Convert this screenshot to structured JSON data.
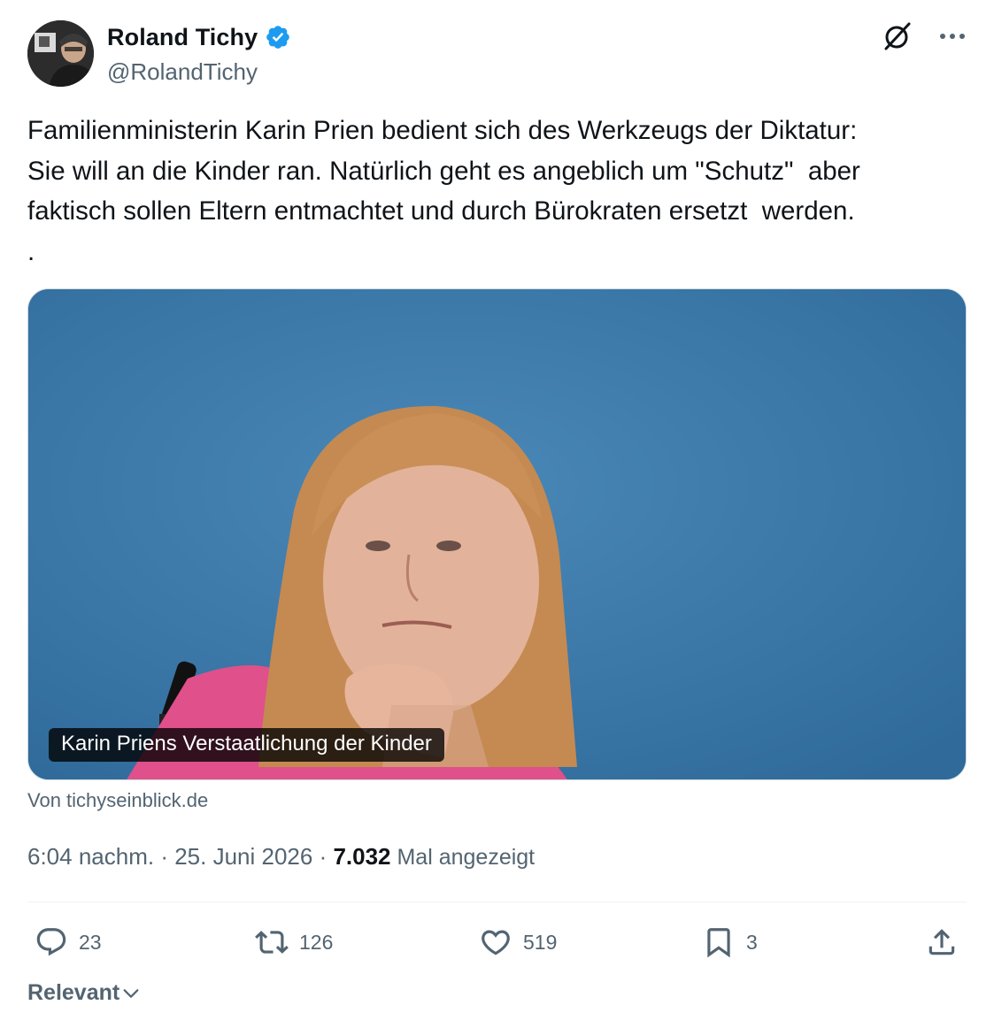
{
  "author": {
    "name": "Roland Tichy",
    "handle": "@RolandTichy",
    "verified": true
  },
  "tweet": {
    "text": "Familienministerin Karin Prien bedient sich des Werkzeugs der Diktatur:\nSie will an die Kinder ran. Natürlich geht es angeblich um \"Schutz\"  aber\nfaktisch sollen Eltern entmachtet und durch Bürokraten ersetzt  werden.\n."
  },
  "card": {
    "caption": "Karin Priens Verstaatlichung der Kinder",
    "source": "Von tichyseinblick.de"
  },
  "meta": {
    "time": "6:04 nachm.",
    "separator": " · ",
    "date": "25. Juni 2026",
    "views_count": "7.032",
    "views_label": " Mal angezeigt"
  },
  "actions": {
    "replies": "23",
    "reposts": "126",
    "likes": "519",
    "bookmarks": "3"
  },
  "sort": {
    "label": "Relevant"
  },
  "colors": {
    "text_primary": "#0f1419",
    "text_secondary": "#536471",
    "verified_blue": "#1d9bf0",
    "divider": "#eff3f4",
    "photo_background": "#3a78a8"
  },
  "icons": [
    "verified-badge-icon",
    "grok-icon",
    "more-icon",
    "reply-icon",
    "repost-icon",
    "like-icon",
    "bookmark-icon",
    "share-icon",
    "chevron-down-icon"
  ]
}
